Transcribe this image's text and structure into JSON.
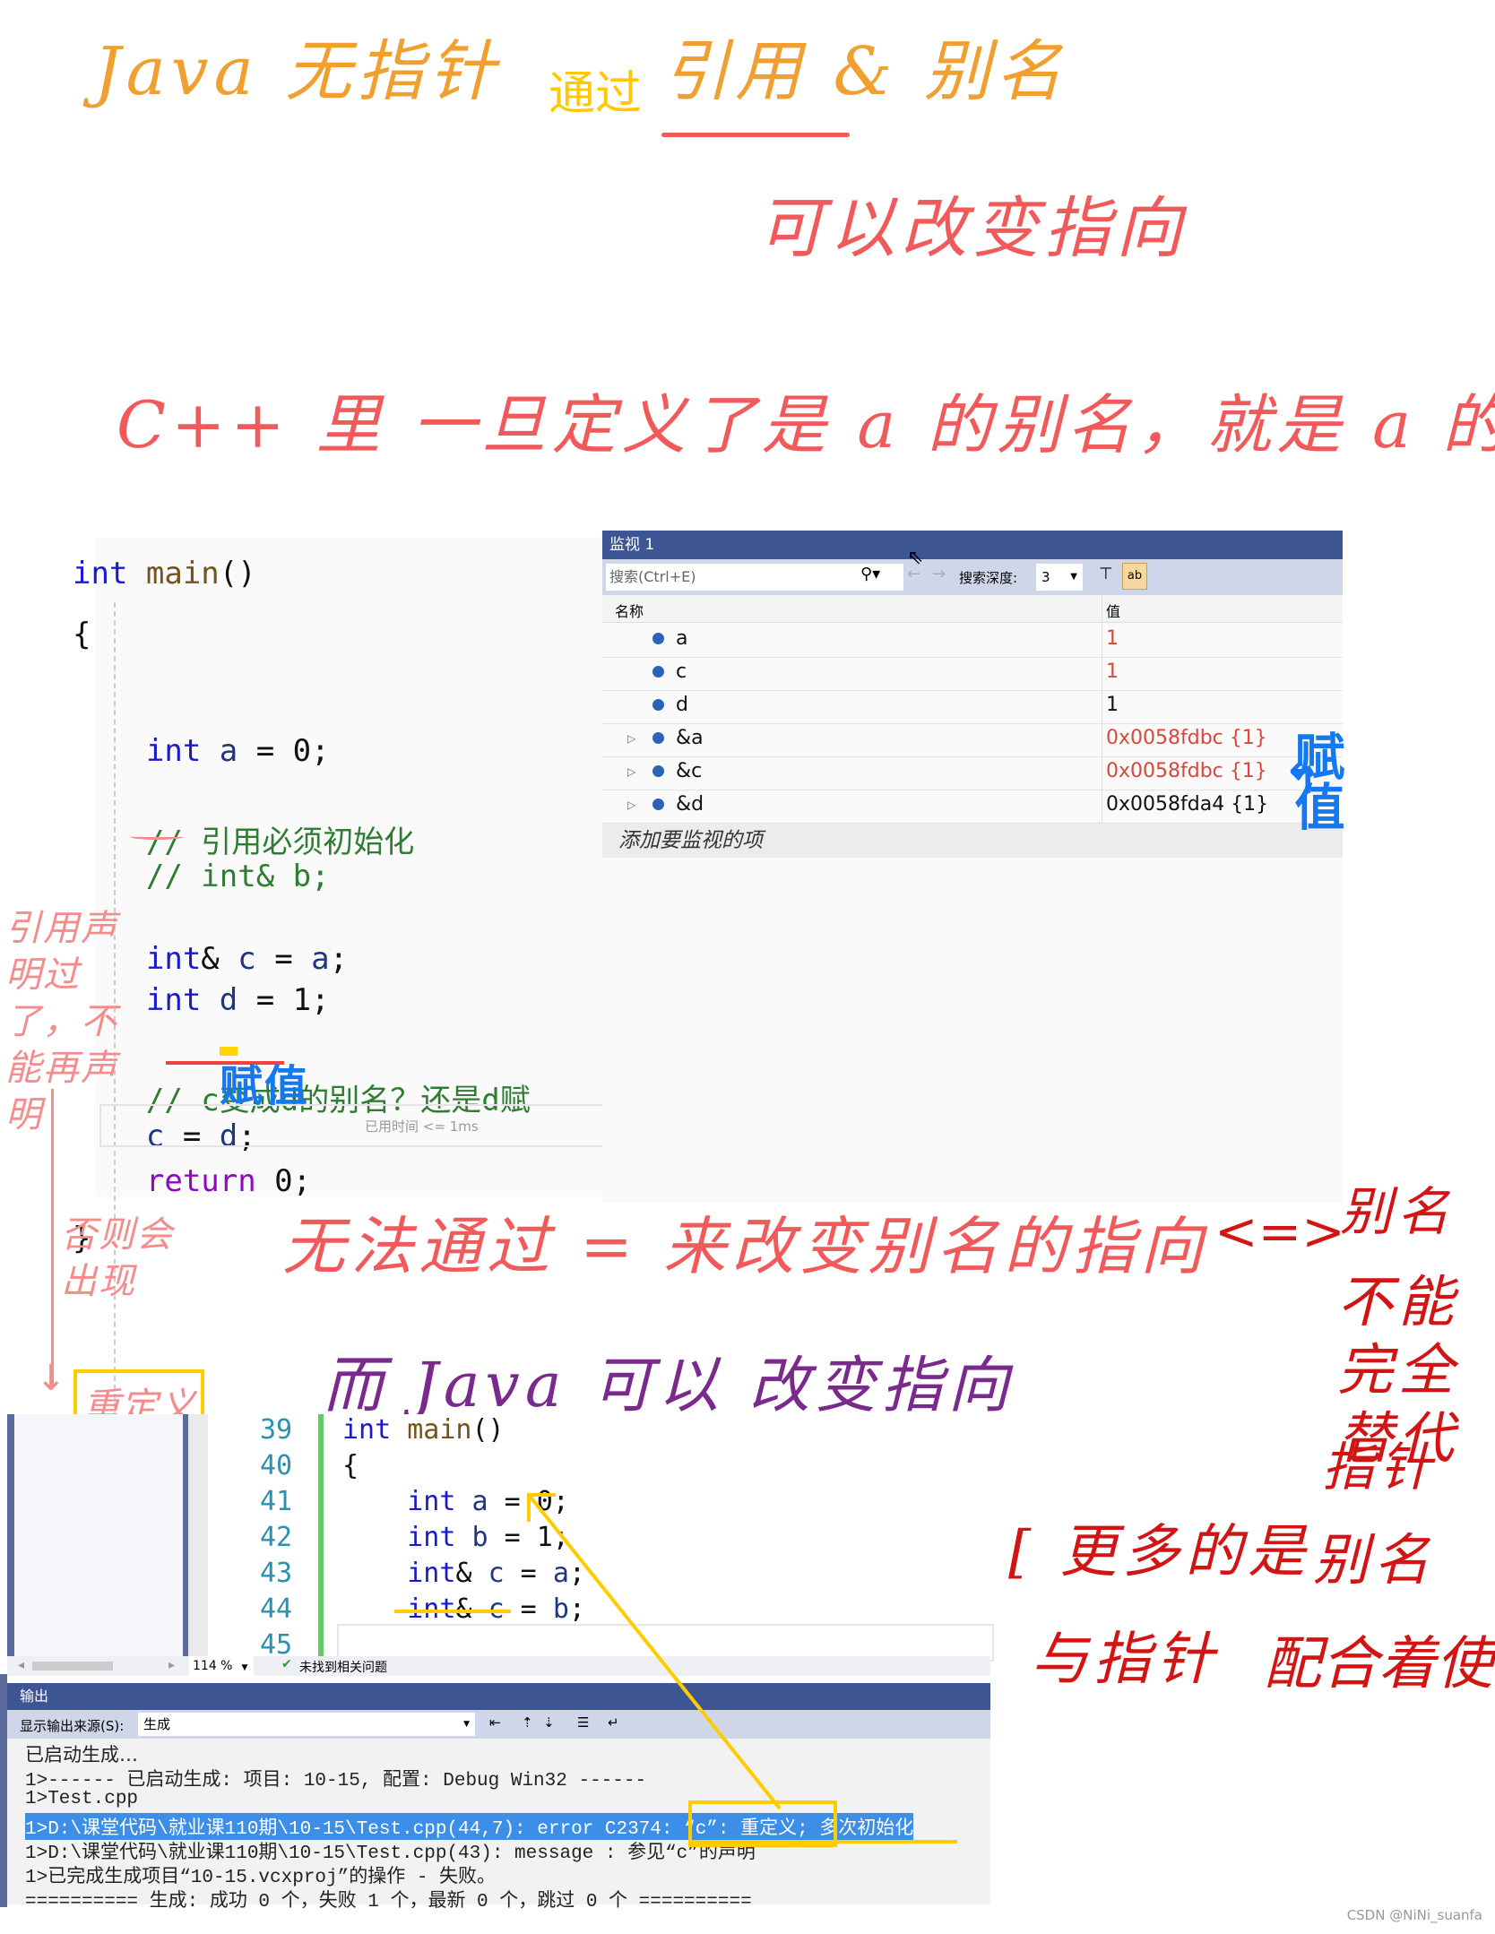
{
  "annotations": {
    "title_line": {
      "java_no_pointer": "Java 无指针",
      "via": "通过",
      "ref_alias": "引用 & 别名"
    },
    "can_change": "可以改变指向",
    "cpp_line": "C++ 里  一旦定义了是 a 的别名，就是 a 的别名",
    "assign_blue": "赋值",
    "watch_note": "赋值",
    "left_note": "引用声明过了，不能再声明",
    "else_note": "否则会出现",
    "redefine": "重定义",
    "cannot_change": "无法通过 = 来改变别名的指向",
    "vs": "<=>",
    "alias_word": "别名",
    "not_fully_replace": "不能完全替代",
    "pointer_word": "指针",
    "java_can": "而 Java 可以 改变指向",
    "more_is": "[ 更多的是",
    "alias2": "别名",
    "with_pointer": "与指针",
    "cooperate": "配合着使用"
  },
  "editor1": {
    "lines": [
      {
        "tokens": [
          {
            "t": "int",
            "c": "kw"
          },
          {
            "t": " main",
            "c": "fn"
          },
          {
            "t": "()",
            "c": "plain"
          }
        ]
      },
      {
        "tokens": [
          {
            "t": "{",
            "c": "plain"
          }
        ]
      },
      {
        "tokens": [
          {
            "t": "    int",
            "c": "kw"
          },
          {
            "t": " a",
            "c": "var"
          },
          {
            "t": " = 0;",
            "c": "plain"
          }
        ]
      },
      {
        "tokens": [
          {
            "t": "    // 引用必须初始化",
            "c": "cm"
          }
        ]
      },
      {
        "tokens": [
          {
            "t": "    // int& b;",
            "c": "cm"
          }
        ]
      },
      {
        "tokens": [
          {
            "t": "    int",
            "c": "kw"
          },
          {
            "t": "& ",
            "c": "plain"
          },
          {
            "t": "c",
            "c": "var"
          },
          {
            "t": " = ",
            "c": "plain"
          },
          {
            "t": "a",
            "c": "var"
          },
          {
            "t": ";",
            "c": "plain"
          }
        ]
      },
      {
        "tokens": [
          {
            "t": "    int",
            "c": "kw"
          },
          {
            "t": " d",
            "c": "var"
          },
          {
            "t": " = 1;",
            "c": "plain"
          }
        ]
      },
      {
        "tokens": [
          {
            "t": "    // c变成d的别名？还是d赋",
            "c": "cm"
          }
        ]
      },
      {
        "tokens": [
          {
            "t": "    c",
            "c": "var"
          },
          {
            "t": " = ",
            "c": "plain"
          },
          {
            "t": "d",
            "c": "var"
          },
          {
            "t": ";",
            "c": "plain"
          }
        ]
      },
      {
        "tokens": [
          {
            "t": "    return",
            "c": "ret"
          },
          {
            "t": " 0;",
            "c": "plain"
          }
        ]
      },
      {
        "tokens": [
          {
            "t": "}",
            "c": "plain"
          }
        ]
      }
    ],
    "elapsed": "已用时间 <= 1ms"
  },
  "watch": {
    "title": "监视 1",
    "search_placeholder": "搜索(Ctrl+E)",
    "depth_label": "搜索深度:",
    "depth_value": "3",
    "col_name": "名称",
    "col_value": "值",
    "rows": [
      {
        "name": "a",
        "value": "1",
        "changed": true,
        "expandable": false
      },
      {
        "name": "c",
        "value": "1",
        "changed": true,
        "expandable": false
      },
      {
        "name": "d",
        "value": "1",
        "changed": false,
        "expandable": false
      },
      {
        "name": "&a",
        "value": "0x0058fdbc {1}",
        "changed": true,
        "expandable": true
      },
      {
        "name": "&c",
        "value": "0x0058fdbc {1}",
        "changed": true,
        "expandable": true
      },
      {
        "name": "&d",
        "value": "0x0058fda4 {1}",
        "changed": false,
        "expandable": true
      }
    ],
    "add_item": "添加要监视的项",
    "colors": {
      "changed": "#d9473a",
      "normal": "#111111"
    }
  },
  "ide2": {
    "line_numbers": [
      "39",
      "40",
      "41",
      "42",
      "43",
      "44",
      "45"
    ],
    "code": [
      [
        {
          "t": "int",
          "c": "kw"
        },
        {
          "t": " main",
          "c": "fn"
        },
        {
          "t": "()",
          "c": "plain"
        }
      ],
      [
        {
          "t": "{",
          "c": "plain"
        }
      ],
      [
        {
          "t": "    int",
          "c": "kw"
        },
        {
          "t": " a",
          "c": "var"
        },
        {
          "t": " = 0;",
          "c": "plain"
        }
      ],
      [
        {
          "t": "    int",
          "c": "kw"
        },
        {
          "t": " b",
          "c": "var"
        },
        {
          "t": " = 1;",
          "c": "plain"
        }
      ],
      [
        {
          "t": "    int",
          "c": "kw"
        },
        {
          "t": "& ",
          "c": "plain"
        },
        {
          "t": "c",
          "c": "var"
        },
        {
          "t": " = ",
          "c": "plain"
        },
        {
          "t": "a",
          "c": "var"
        },
        {
          "t": ";",
          "c": "plain"
        }
      ],
      [
        {
          "t": "    int",
          "c": "kw"
        },
        {
          "t": "& ",
          "c": "plain"
        },
        {
          "t": "c",
          "c": "var"
        },
        {
          "t": " = ",
          "c": "plain"
        },
        {
          "t": "b",
          "c": "var"
        },
        {
          "t": ";",
          "c": "plain"
        }
      ]
    ],
    "zoom": "114 %",
    "issues": "未找到相关问题",
    "output_title": "输出",
    "source_label": "显示输出来源(S):",
    "source_value": "生成",
    "output_lines": [
      "已启动生成…",
      "1>------ 已启动生成: 项目: 10-15, 配置: Debug Win32 ------",
      "1>Test.cpp",
      "1>D:\\课堂代码\\就业课110期\\10-15\\Test.cpp(44,7): error C2374: “c”: 重定义; 多次初始化",
      "1>D:\\课堂代码\\就业课110期\\10-15\\Test.cpp(43): message : 参见“c”的声明",
      "1>已完成生成项目“10-15.vcxproj”的操作 - 失败。",
      "========== 生成: 成功 0 个，失败 1 个，最新 0 个，跳过 0 个 =========="
    ],
    "highlight_line": 3
  },
  "watermark": "CSDN @NiNi_suanfa"
}
